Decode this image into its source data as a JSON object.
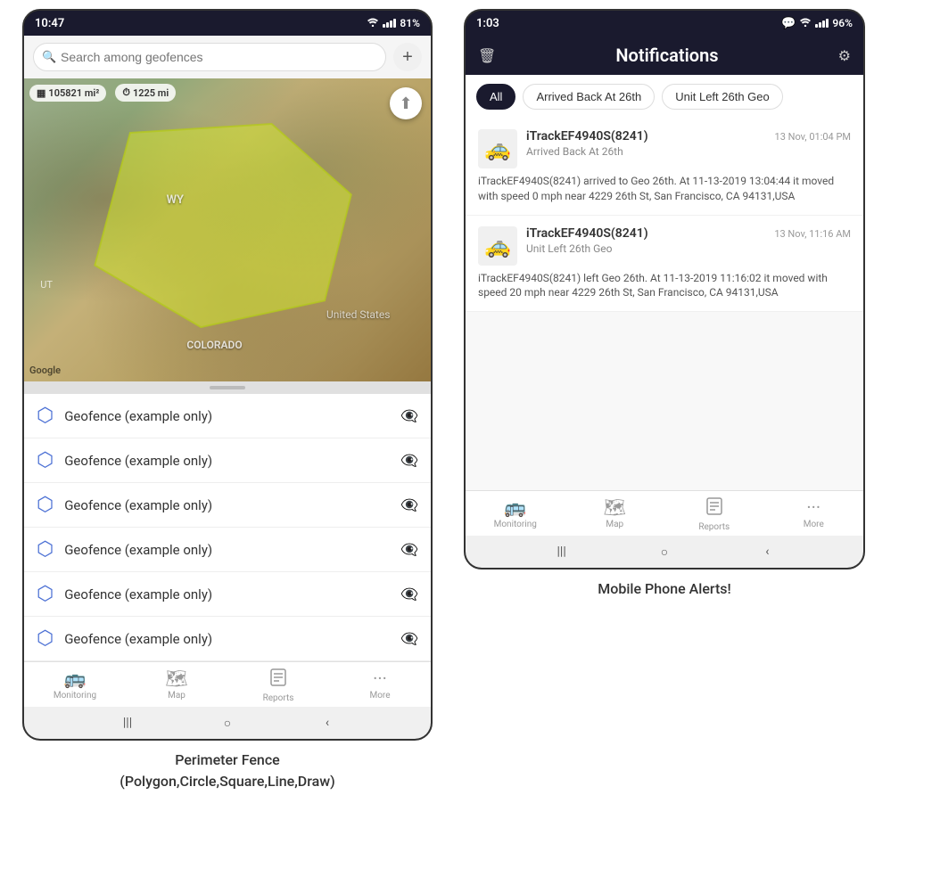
{
  "left_phone": {
    "status_bar": {
      "time": "10:47",
      "battery": "81%",
      "wifi": "WiFi",
      "signal": "Signal"
    },
    "search": {
      "placeholder": "Search among geofences"
    },
    "map": {
      "area": "105821 mi²",
      "distance": "1225 mi",
      "state_label": "WY",
      "us_label": "United States",
      "ut_label": "UT",
      "co_label": "COLORADO",
      "google_label": "Google"
    },
    "geofence_items": [
      {
        "name": "Geofence (example only)"
      },
      {
        "name": "Geofence (example only)"
      },
      {
        "name": "Geofence (example only)"
      },
      {
        "name": "Geofence (example only)"
      },
      {
        "name": "Geofence (example only)"
      },
      {
        "name": "Geofence (example only)"
      }
    ],
    "bottom_nav": [
      {
        "label": "Monitoring",
        "icon": "🚌"
      },
      {
        "label": "Map",
        "icon": "🗺"
      },
      {
        "label": "Reports",
        "icon": "📊"
      },
      {
        "label": "More",
        "icon": "···"
      }
    ]
  },
  "right_phone": {
    "status_bar": {
      "time": "1:03",
      "battery": "96%"
    },
    "header": {
      "title": "Notifications",
      "left_icon": "trash",
      "right_icon": "gear"
    },
    "filter_tabs": [
      {
        "label": "All",
        "active": true
      },
      {
        "label": "Arrived Back At 26th",
        "active": false
      },
      {
        "label": "Unit Left 26th Geo",
        "active": false
      }
    ],
    "notifications": [
      {
        "vehicle": "iTrackEF4940S(8241)",
        "timestamp": "13 Nov, 01:04 PM",
        "event": "Arrived Back At 26th",
        "description": "iTrackEF4940S(8241) arrived to Geo 26th.   At 11-13-2019 13:04:44 it moved with speed 0 mph near 4229 26th St, San Francisco, CA 94131,USA"
      },
      {
        "vehicle": "iTrackEF4940S(8241)",
        "timestamp": "13 Nov, 11:16 AM",
        "event": "Unit Left 26th Geo",
        "description": "iTrackEF4940S(8241) left Geo 26th.   At 11-13-2019 11:16:02 it moved with speed 20 mph near 4229 26th St, San Francisco, CA 94131,USA"
      }
    ],
    "bottom_nav": [
      {
        "label": "Monitoring",
        "icon": "🚌"
      },
      {
        "label": "Map",
        "icon": "🗺"
      },
      {
        "label": "Reports",
        "icon": "📊"
      },
      {
        "label": "More",
        "icon": "···"
      }
    ]
  },
  "captions": {
    "left": "Perimeter Fence\n(Polygon,Circle,Square,Line,Draw)",
    "right": "Mobile Phone Alerts!"
  }
}
